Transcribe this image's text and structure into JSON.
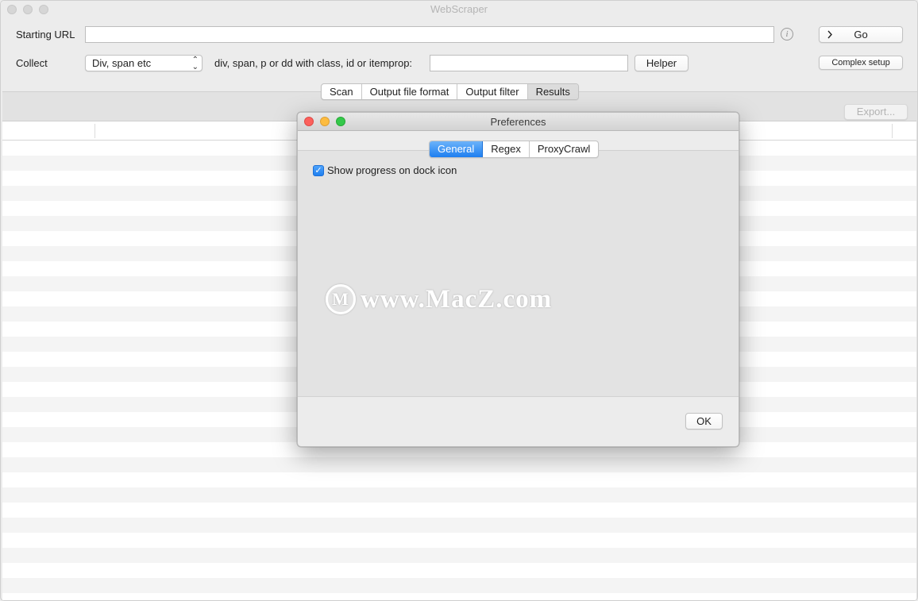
{
  "window": {
    "title": "WebScraper"
  },
  "form": {
    "starting_url_label": "Starting URL",
    "starting_url_value": "",
    "go_label": "Go",
    "collect_label": "Collect",
    "collect_selected": "Div, span etc",
    "selector_label": "div, span, p or dd with class, id or itemprop:",
    "selector_value": "",
    "helper_label": "Helper",
    "complex_setup_label": "Complex setup"
  },
  "main_tabs": [
    {
      "label": "Scan"
    },
    {
      "label": "Output file format"
    },
    {
      "label": "Output filter"
    },
    {
      "label": "Results",
      "selected": true
    }
  ],
  "results": {
    "export_label": "Export..."
  },
  "preferences": {
    "title": "Preferences",
    "tabs": [
      {
        "label": "General",
        "active": true
      },
      {
        "label": "Regex"
      },
      {
        "label": "ProxyCrawl"
      }
    ],
    "show_progress_label": "Show progress on dock icon",
    "show_progress_checked": true,
    "ok_label": "OK"
  },
  "watermark": {
    "text": "www.MacZ.com",
    "logo_letter": "M"
  },
  "colors": {
    "accent": "#1d7ef0",
    "close": "#fc605c",
    "minimize": "#fdbc40",
    "zoom": "#34c84a"
  }
}
